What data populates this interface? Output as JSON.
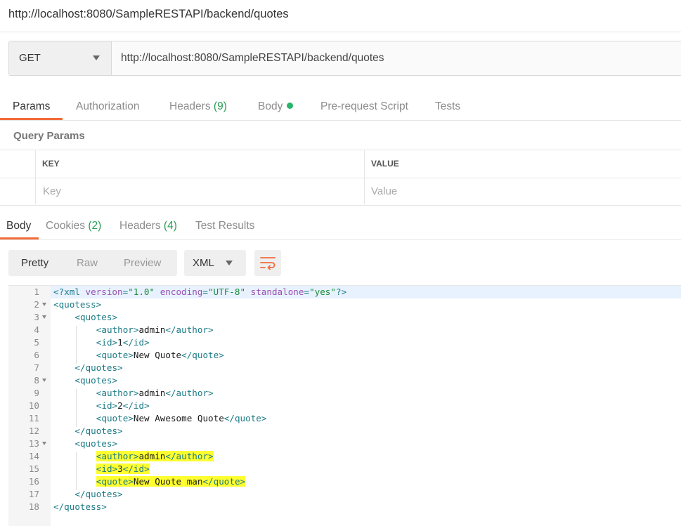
{
  "window": {
    "title": "http://localhost:8080/SampleRESTAPI/backend/quotes"
  },
  "request": {
    "method": "GET",
    "url": "http://localhost:8080/SampleRESTAPI/backend/quotes"
  },
  "request_tabs": {
    "params": "Params",
    "authorization": "Authorization",
    "headers": "Headers",
    "headers_count": "(9)",
    "body": "Body",
    "prerequest": "Pre-request Script",
    "tests": "Tests"
  },
  "query_params": {
    "title": "Query Params",
    "key_header": "KEY",
    "value_header": "VALUE",
    "key_placeholder": "Key",
    "value_placeholder": "Value"
  },
  "response_tabs": {
    "body": "Body",
    "cookies": "Cookies",
    "cookies_count": "(2)",
    "headers": "Headers",
    "headers_count": "(4)",
    "test_results": "Test Results"
  },
  "view_modes": {
    "pretty": "Pretty",
    "raw": "Raw",
    "preview": "Preview"
  },
  "format": {
    "selected": "XML"
  },
  "icons": {
    "wrap": "wrap-lines-icon",
    "dropdown": "chevron-down-icon",
    "fold": "fold-arrow-icon"
  },
  "colors": {
    "accent": "#f26b3a",
    "count_green": "#2a9d55",
    "status_dot": "#26b56a",
    "highlight": "#ffff30"
  },
  "xml_decl": {
    "open": "<?xml",
    "attr1": "version",
    "eq": "=",
    "val1": "\"1.0\"",
    "attr2": "encoding",
    "val2": "\"UTF-8\"",
    "attr3": "standalone",
    "val3": "\"yes\"",
    "close": "?>"
  },
  "code": {
    "line_numbers": [
      "1",
      "2",
      "3",
      "4",
      "5",
      "6",
      "7",
      "8",
      "9",
      "10",
      "11",
      "12",
      "13",
      "14",
      "15",
      "16",
      "17",
      "18"
    ],
    "quotess_open": "<quotess>",
    "quotess_close": "</quotess>",
    "quotes_open": "<quotes>",
    "quotes_close": "</quotes>",
    "author_open": "<author>",
    "author_close": "</author>",
    "id_open": "<id>",
    "id_close": "</id>",
    "quote_open": "<quote>",
    "quote_close": "</quote>",
    "records": [
      {
        "author": "admin",
        "id": "1",
        "quote": "New Quote"
      },
      {
        "author": "admin",
        "id": "2",
        "quote": "New Awesome Quote"
      },
      {
        "author": "admin",
        "id": "3",
        "quote": "New Quote man"
      }
    ]
  }
}
